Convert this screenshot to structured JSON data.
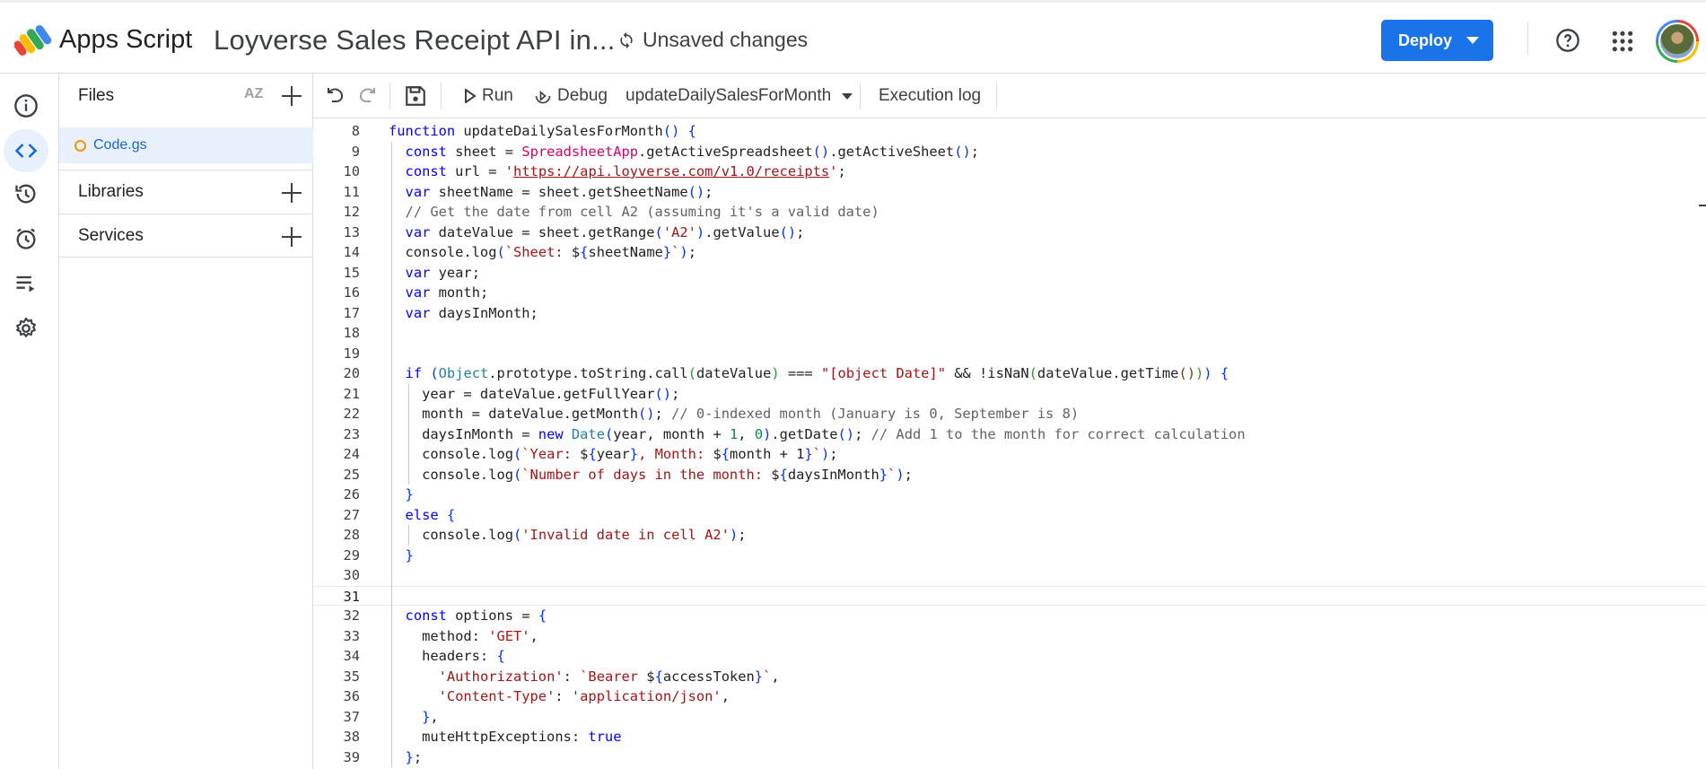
{
  "header": {
    "app_name": "Apps Script",
    "project_title": "Loyverse Sales Receipt API in...",
    "status": "Unsaved changes",
    "deploy_label": "Deploy"
  },
  "file_panel": {
    "files_label": "Files",
    "sort_label": "AZ",
    "file_name": "Code.gs",
    "libraries_label": "Libraries",
    "services_label": "Services"
  },
  "toolbar": {
    "run_label": "Run",
    "debug_label": "Debug",
    "function_select": "updateDailySalesForMonth",
    "execution_log_label": "Execution log"
  },
  "editor": {
    "current_line": 31,
    "line_numbers": [
      "8",
      "9",
      "10",
      "11",
      "12",
      "13",
      "14",
      "15",
      "16",
      "17",
      "18",
      "19",
      "20",
      "21",
      "22",
      "23",
      "24",
      "25",
      "26",
      "27",
      "28",
      "29",
      "30",
      "31",
      "32",
      "33",
      "34",
      "35",
      "36",
      "37",
      "38",
      "39"
    ],
    "code_lines": [
      "function updateDailySalesForMonth() {",
      "  const sheet = SpreadsheetApp.getActiveSpreadsheet().getActiveSheet();",
      "  const url = 'https://api.loyverse.com/v1.0/receipts';",
      "  var sheetName = sheet.getSheetName();",
      "  // Get the date from cell A2 (assuming it's a valid date)",
      "  var dateValue = sheet.getRange('A2').getValue();",
      "  console.log(`Sheet: ${sheetName}`);",
      "  var year;",
      "  var month;",
      "  var daysInMonth;",
      "",
      "",
      "  if (Object.prototype.toString.call(dateValue) === \"[object Date]\" && !isNaN(dateValue.getTime())) {",
      "    year = dateValue.getFullYear();",
      "    month = dateValue.getMonth(); // 0-indexed month (January is 0, September is 8)",
      "    daysInMonth = new Date(year, month + 1, 0).getDate(); // Add 1 to the month for correct calculation",
      "    console.log(`Year: ${year}, Month: ${month + 1}`);",
      "    console.log(`Number of days in the month: ${daysInMonth}`);",
      "  }",
      "  else {",
      "    console.log('Invalid date in cell A2');",
      "  }",
      "",
      "",
      "  const options = {",
      "    method: 'GET',",
      "    headers: {",
      "      'Authorization': `Bearer ${accessToken}`,",
      "      'Content-Type': 'application/json',",
      "    },",
      "    muteHttpExceptions: true",
      "  };"
    ]
  },
  "colors": {
    "accent": "#1a73e8",
    "keyword": "#0000ff",
    "string": "#a31515",
    "comment": "#5f6368",
    "number": "#098658",
    "class": "#d6006d"
  }
}
